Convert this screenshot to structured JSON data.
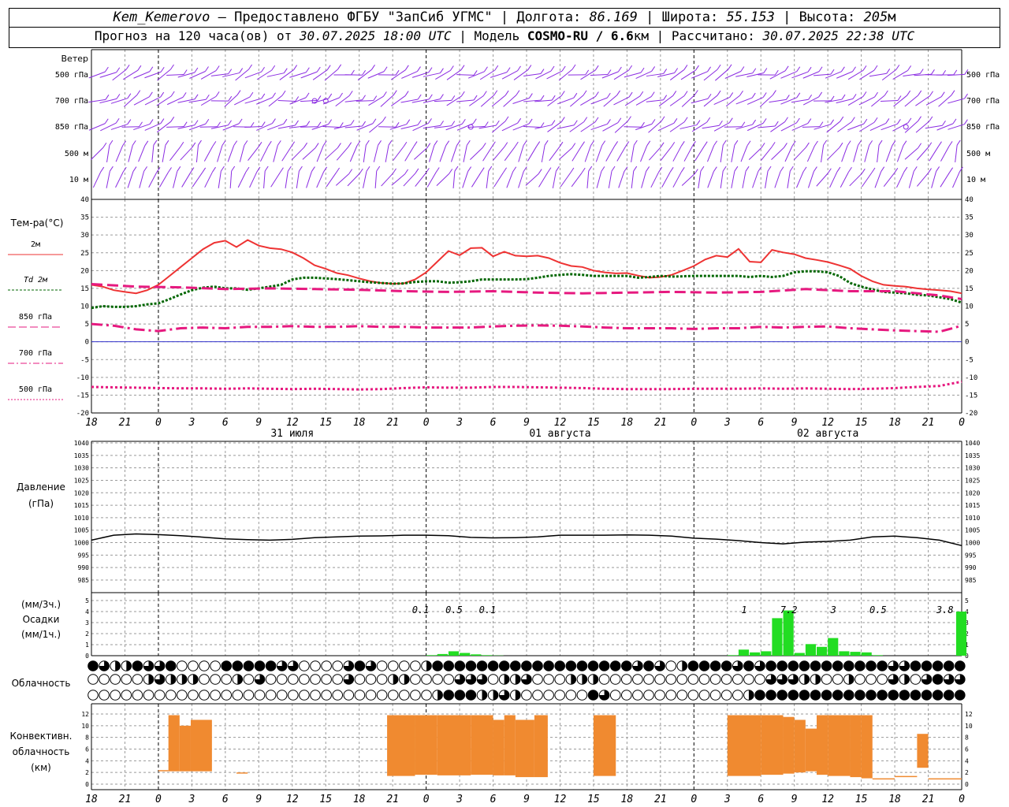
{
  "header": {
    "station": "Kem_Kemerovo",
    "dash": " — ",
    "provider": "Предоставлено ФГБУ \"ЗапСиб УГМС\"",
    "sep": " | ",
    "lon_label": "Долгота: ",
    "lon": "86.169",
    "lat_label": "Широта: ",
    "lat": "55.153",
    "alt_label": "Высота: ",
    "alt": "205",
    "alt_unit": "м",
    "forecast_prefix": "Прогноз на 120 часа(ов) от ",
    "forecast_time": "30.07.2025 18:00 UTC",
    "model_prefix": "  | Модель ",
    "model": "COSMO-RU / 6.6",
    "model_unit": "км",
    "calc_prefix": " | Рассчитано: ",
    "calc_time": "30.07.2025 22:38 UTC"
  },
  "colors": {
    "t2m": "#ee3333",
    "td": "#006600",
    "t850": "#e6197f",
    "t700": "#e6197f",
    "t500": "#e6197f",
    "wind": "#8a2be2",
    "pressure": "#000000",
    "precip": "#22dd22",
    "convective": "#f08a30",
    "zero_line": "#3333cc",
    "grid": "#9a9a9a"
  },
  "x_axis": {
    "tick_labels": [
      "18",
      "21",
      "0",
      "3",
      "6",
      "9",
      "12",
      "15",
      "18",
      "21",
      "0",
      "3",
      "6",
      "9",
      "12",
      "15",
      "18",
      "21",
      "0",
      "3",
      "6",
      "9",
      "12",
      "15",
      "18",
      "21",
      "0"
    ],
    "day_labels": [
      "31 июля",
      "01 августа",
      "02 августа"
    ],
    "hours_start": 0,
    "hours_end": 78
  },
  "wind_panel": {
    "title": "Ветер",
    "levels": [
      "500 гПа",
      "700 гПа",
      "850 гПа",
      "500 м",
      "10  м"
    ]
  },
  "temperature_panel": {
    "title": "Тем-ра(°C)",
    "legend": [
      {
        "id": "t2m",
        "label": "2м"
      },
      {
        "id": "td",
        "label": "Td  2м"
      },
      {
        "id": "t850",
        "label": "850 гПа"
      },
      {
        "id": "t700",
        "label": "700 гПа"
      },
      {
        "id": "t500",
        "label": "500 гПа"
      }
    ],
    "y_ticks": [
      "40",
      "35",
      "30",
      "25",
      "20",
      "15",
      "10",
      "5",
      "0",
      "-5",
      "-10",
      "-15",
      "-20"
    ]
  },
  "pressure_panel": {
    "title_line1": "Давление",
    "title_line2": "(гПа)",
    "y_ticks": [
      "1040",
      "1035",
      "1030",
      "1025",
      "1020",
      "1015",
      "1010",
      "1005",
      "1000",
      "995",
      "990",
      "985"
    ]
  },
  "precip_panel": {
    "unit_3h": "(мм/3ч.)",
    "title": "Осадки",
    "unit_1h": "(мм/1ч.)",
    "y_ticks": [
      "5",
      "4",
      "3",
      "2",
      "1",
      "0"
    ],
    "labels": [
      {
        "hour": 29.5,
        "text": "0.1"
      },
      {
        "hour": 32.5,
        "text": "0.5"
      },
      {
        "hour": 35.5,
        "text": "0.1"
      },
      {
        "hour": 58.5,
        "text": "1"
      },
      {
        "hour": 62.5,
        "text": "7.2"
      },
      {
        "hour": 66.5,
        "text": "3"
      },
      {
        "hour": 70.5,
        "text": "0.5"
      },
      {
        "hour": 76.5,
        "text": "3.8"
      }
    ]
  },
  "cloud_panel": {
    "title": "Облачность"
  },
  "conv_panel": {
    "title_line1": "Конвективн.",
    "title_line2": "облачность",
    "title_line3": "(км)",
    "y_ticks": [
      "12",
      "10",
      "8",
      "6",
      "4",
      "2",
      "0"
    ]
  },
  "chart_data": {
    "type": "line",
    "x_unit": "hours from 30.07.2025 18:00 UTC",
    "series": [
      {
        "name": "2м",
        "x": [
          0,
          1,
          2,
          3,
          4,
          5,
          6,
          7,
          8,
          9,
          10,
          11,
          12,
          13,
          14,
          15,
          16,
          17,
          18,
          19,
          20,
          21,
          22,
          23,
          24,
          25,
          26,
          27,
          28,
          29,
          30,
          31,
          32,
          33,
          34,
          35,
          36,
          37,
          38,
          39,
          40,
          41,
          42,
          43,
          44,
          45,
          46,
          47,
          48,
          49,
          50,
          51,
          52,
          53,
          54,
          55,
          56,
          57,
          58,
          59,
          60,
          61,
          62,
          63,
          64,
          65,
          66,
          67,
          68,
          69,
          70,
          71,
          72,
          73,
          74,
          75,
          76,
          77,
          78
        ],
        "y": [
          16,
          15.5,
          14.5,
          14,
          13.6,
          14.5,
          16,
          18.5,
          21,
          23.5,
          26,
          27.8,
          28.4,
          26.6,
          28.6,
          27,
          26.3,
          26,
          25.1,
          23.5,
          21.5,
          20.5,
          19.3,
          18.7,
          17.8,
          17,
          16.5,
          16.3,
          16.4,
          17.5,
          19.5,
          22.5,
          25.5,
          24.3,
          26.3,
          26.4,
          24,
          25.3,
          24.2,
          24,
          24.2,
          23.5,
          22.2,
          21.3,
          21,
          20,
          19.5,
          19.2,
          19.3,
          18.6,
          18,
          18.2,
          18.8,
          20,
          21.3,
          23.1,
          24.2,
          23.8,
          26.1,
          22.5,
          22.3,
          25.8,
          25.1,
          24.6,
          23.5,
          23,
          22.4,
          21.5,
          20.5,
          18.5,
          17,
          16,
          15.7,
          15.5,
          15,
          14.7,
          14.5,
          14.2,
          13.6
        ]
      },
      {
        "name": "Td  2м",
        "x": [
          0,
          1,
          2,
          3,
          4,
          5,
          6,
          7,
          8,
          9,
          10,
          11,
          12,
          13,
          14,
          15,
          16,
          17,
          18,
          19,
          20,
          21,
          22,
          23,
          24,
          25,
          26,
          27,
          28,
          29,
          30,
          31,
          32,
          33,
          34,
          35,
          36,
          37,
          38,
          39,
          40,
          41,
          42,
          43,
          44,
          45,
          46,
          47,
          48,
          49,
          50,
          51,
          52,
          53,
          54,
          55,
          56,
          57,
          58,
          59,
          60,
          61,
          62,
          63,
          64,
          65,
          66,
          67,
          68,
          69,
          70,
          71,
          72,
          73,
          74,
          75,
          76,
          77,
          78
        ],
        "y": [
          9.5,
          10,
          9.8,
          9.8,
          10,
          10.5,
          10.8,
          12,
          13.3,
          14.5,
          15.2,
          15.5,
          15,
          15,
          14.6,
          15,
          15.5,
          16,
          17.5,
          18,
          18,
          17.8,
          17.6,
          17.3,
          17,
          16.7,
          16.5,
          16.3,
          16.4,
          16.8,
          17,
          17,
          16.6,
          16.7,
          17,
          17.5,
          17.5,
          17.5,
          17.5,
          17.6,
          18,
          18.5,
          18.8,
          19,
          18.8,
          18.5,
          18.5,
          18.5,
          18.5,
          18,
          18.2,
          18.5,
          18.3,
          18.4,
          18.5,
          18.5,
          18.5,
          18.5,
          18.5,
          18.2,
          18.5,
          18.2,
          18.5,
          19.5,
          19.8,
          19.8,
          19.5,
          18.5,
          16.5,
          15.5,
          14.7,
          14,
          13.8,
          13.6,
          13.2,
          13,
          12.5,
          12,
          11
        ]
      },
      {
        "name": "850 гПа",
        "x": [
          0,
          4,
          8,
          12,
          16,
          20,
          24,
          28,
          32,
          36,
          40,
          44,
          48,
          52,
          56,
          60,
          64,
          68,
          72,
          76,
          78
        ],
        "y": [
          16.2,
          15.5,
          15.3,
          14.8,
          15,
          14.8,
          14.6,
          14.2,
          14,
          14.2,
          13.8,
          13.6,
          13.8,
          14,
          13.8,
          14,
          14.8,
          14.2,
          14.2,
          13,
          12
        ]
      },
      {
        "name": "700 гПа",
        "x": [
          0,
          2,
          4,
          6,
          8,
          10,
          12,
          14,
          16,
          18,
          20,
          22,
          24,
          26,
          28,
          30,
          32,
          34,
          36,
          38,
          40,
          42,
          44,
          46,
          48,
          50,
          52,
          54,
          56,
          58,
          60,
          62,
          64,
          66,
          68,
          70,
          72,
          74,
          76,
          78
        ],
        "y": [
          5,
          4.5,
          3.5,
          3,
          3.8,
          4,
          3.8,
          4.2,
          4.2,
          4.4,
          4.2,
          4.2,
          4.4,
          4.2,
          4.2,
          4.0,
          4.0,
          4.0,
          4.3,
          4.5,
          4.6,
          4.5,
          4.3,
          4.0,
          3.8,
          3.8,
          3.8,
          3.6,
          3.8,
          3.8,
          4.2,
          4.0,
          4.2,
          4.3,
          3.8,
          3.5,
          3.2,
          3.0,
          2.8,
          4.5
        ]
      },
      {
        "name": "500 гПа",
        "x": [
          0,
          2,
          4,
          6,
          8,
          10,
          12,
          14,
          16,
          18,
          20,
          22,
          24,
          26,
          28,
          30,
          32,
          34,
          36,
          38,
          40,
          42,
          44,
          46,
          48,
          50,
          52,
          54,
          56,
          58,
          60,
          62,
          64,
          66,
          68,
          70,
          72,
          74,
          76,
          78
        ],
        "y": [
          -12.7,
          -12.8,
          -12.9,
          -13,
          -13.1,
          -13.1,
          -13.2,
          -13.1,
          -13.2,
          -13.3,
          -13.2,
          -13.3,
          -13.4,
          -13.3,
          -13,
          -12.8,
          -12.9,
          -12.9,
          -12.7,
          -12.7,
          -12.8,
          -12.9,
          -13,
          -13.2,
          -13.3,
          -13.3,
          -13.3,
          -13.2,
          -13.2,
          -13.2,
          -13.1,
          -13.2,
          -13.1,
          -13.2,
          -13.3,
          -13.2,
          -13,
          -12.7,
          -12.4,
          -11.2
        ]
      },
      {
        "name": "Давление",
        "x": [
          0,
          2,
          4,
          6,
          8,
          10,
          12,
          14,
          16,
          18,
          20,
          22,
          24,
          26,
          28,
          30,
          32,
          34,
          36,
          38,
          40,
          42,
          44,
          46,
          48,
          50,
          52,
          54,
          56,
          58,
          60,
          62,
          64,
          66,
          68,
          70,
          72,
          74,
          76,
          78
        ],
        "y": [
          1001,
          1003,
          1003.5,
          1003.2,
          1002.8,
          1002.2,
          1001.5,
          1001.2,
          1001,
          1001.3,
          1002,
          1002.3,
          1002.6,
          1002.7,
          1003,
          1003,
          1002.8,
          1002.1,
          1001.9,
          1002,
          1002.3,
          1003,
          1003,
          1003,
          1003.1,
          1003,
          1002.6,
          1001.8,
          1001.4,
          1000.8,
          1000,
          999.5,
          1000.2,
          1000.5,
          1001,
          1002.3,
          1002.6,
          1002,
          1001,
          998.8
        ]
      }
    ],
    "precip_x": [
      30,
      31,
      32,
      33,
      34,
      35,
      36,
      57,
      58,
      59,
      60,
      61,
      62,
      63,
      64,
      65,
      66,
      67,
      68,
      69,
      70,
      77.5
    ],
    "precip_y": [
      0.05,
      0.15,
      0.4,
      0.25,
      0.12,
      0.05,
      0.02,
      0.05,
      0.55,
      0.3,
      0.4,
      3.4,
      4.1,
      0.25,
      1.05,
      0.8,
      1.6,
      0.4,
      0.35,
      0.3,
      0.05,
      4.0
    ],
    "cloud_rows": [
      [
        4,
        3,
        2,
        2,
        4,
        3,
        3,
        4,
        0,
        0,
        0,
        0,
        4,
        4,
        4,
        4,
        4,
        3,
        3,
        0,
        0,
        0,
        0,
        3,
        4,
        3,
        0,
        0,
        0,
        0,
        2,
        4,
        4,
        4,
        4,
        4,
        4,
        4,
        4,
        4,
        4,
        4,
        4,
        4,
        4,
        4,
        4,
        4,
        4,
        3,
        4,
        3,
        0,
        2,
        4,
        4,
        4,
        4,
        3,
        4,
        3,
        4,
        4,
        4,
        4,
        4,
        4,
        4,
        4,
        4,
        4,
        4,
        3,
        3,
        4,
        4,
        4,
        4,
        4
      ],
      [
        0,
        0,
        0,
        0,
        0,
        2,
        3,
        2,
        2,
        2,
        0,
        0,
        0,
        2,
        0,
        3,
        0,
        0,
        0,
        0,
        0,
        0,
        0,
        3,
        0,
        0,
        0,
        2,
        2,
        0,
        0,
        0,
        0,
        3,
        3,
        3,
        0,
        2,
        2,
        3,
        0,
        0,
        0,
        2,
        2,
        2,
        0,
        0,
        0,
        0,
        0,
        0,
        0,
        0,
        0,
        0,
        0,
        0,
        0,
        0,
        0,
        3,
        3,
        3,
        2,
        2,
        0,
        0,
        2,
        0,
        0,
        0,
        3,
        2,
        0,
        3,
        4,
        3,
        3
      ],
      [
        0,
        0,
        0,
        0,
        0,
        0,
        0,
        0,
        0,
        0,
        0,
        0,
        0,
        0,
        0,
        0,
        0,
        0,
        0,
        0,
        0,
        0,
        0,
        0,
        0,
        0,
        0,
        0,
        0,
        0,
        0,
        2,
        4,
        4,
        4,
        2,
        2,
        3,
        2,
        0,
        0,
        0,
        0,
        0,
        0,
        4,
        3,
        0,
        0,
        0,
        0,
        0,
        0,
        0,
        0,
        0,
        0,
        0,
        0,
        2,
        4,
        4,
        4,
        4,
        4,
        4,
        4,
        4,
        4,
        4,
        4,
        4,
        4,
        4,
        4,
        4,
        4,
        4,
        4
      ]
    ],
    "convective": [
      {
        "from": 6.0,
        "to": 6.9,
        "base": 2.2,
        "top": 2.4
      },
      {
        "from": 6.9,
        "to": 7.9,
        "base": 2.2,
        "top": 11.8
      },
      {
        "from": 7.9,
        "to": 8.9,
        "base": 2.2,
        "top": 10.0
      },
      {
        "from": 8.9,
        "to": 10.8,
        "base": 2.2,
        "top": 11.0
      },
      {
        "from": 13.0,
        "to": 14.0,
        "base": 1.8,
        "top": 2.0
      },
      {
        "from": 26.5,
        "to": 29.0,
        "base": 1.4,
        "top": 11.8
      },
      {
        "from": 29.0,
        "to": 31.0,
        "base": 1.6,
        "top": 11.8
      },
      {
        "from": 31.0,
        "to": 34.0,
        "base": 1.5,
        "top": 11.8
      },
      {
        "from": 34.0,
        "to": 36.0,
        "base": 1.6,
        "top": 11.8
      },
      {
        "from": 36.0,
        "to": 37.0,
        "base": 1.5,
        "top": 11.0
      },
      {
        "from": 37.0,
        "to": 38.0,
        "base": 1.5,
        "top": 11.8
      },
      {
        "from": 38.0,
        "to": 39.7,
        "base": 1.2,
        "top": 11.0
      },
      {
        "from": 39.7,
        "to": 40.9,
        "base": 1.2,
        "top": 11.8
      },
      {
        "from": 45.0,
        "to": 47.0,
        "base": 1.4,
        "top": 11.8
      },
      {
        "from": 57.0,
        "to": 60.0,
        "base": 1.4,
        "top": 11.8
      },
      {
        "from": 60.0,
        "to": 62.0,
        "base": 1.6,
        "top": 11.8
      },
      {
        "from": 62.0,
        "to": 63.0,
        "base": 1.8,
        "top": 11.5
      },
      {
        "from": 63.0,
        "to": 64.0,
        "base": 2.0,
        "top": 11.0
      },
      {
        "from": 64.0,
        "to": 65.0,
        "base": 2.2,
        "top": 9.5
      },
      {
        "from": 65.0,
        "to": 66.0,
        "base": 1.6,
        "top": 11.8
      },
      {
        "from": 66.0,
        "to": 68.0,
        "base": 1.4,
        "top": 11.8
      },
      {
        "from": 68.0,
        "to": 69.0,
        "base": 1.2,
        "top": 11.8
      },
      {
        "from": 69.0,
        "to": 70.0,
        "base": 1.0,
        "top": 11.8
      },
      {
        "from": 70.0,
        "to": 72.0,
        "base": 0.8,
        "top": 1.0
      },
      {
        "from": 72.0,
        "to": 74.0,
        "base": 1.2,
        "top": 1.4
      },
      {
        "from": 74.0,
        "to": 75.0,
        "base": 2.8,
        "top": 8.6
      },
      {
        "from": 75.0,
        "to": 78.0,
        "base": 0.8,
        "top": 1.0
      }
    ],
    "wind_ranges": {
      "levels": [
        "500 гПа",
        "700 гПа",
        "850 гПа",
        "500 м",
        "10  м"
      ],
      "calm_marks": [
        {
          "level": "700 гПа",
          "hour": 20
        },
        {
          "level": "700 гПа",
          "hour": 21
        },
        {
          "level": "850 гПа",
          "hour": 34
        },
        {
          "level": "850 гПа",
          "hour": 73
        }
      ]
    }
  }
}
